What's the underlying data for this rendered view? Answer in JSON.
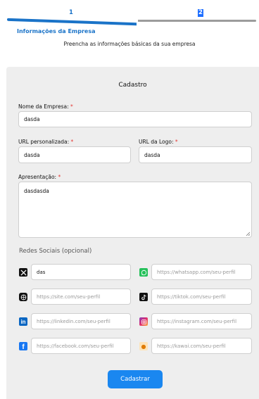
{
  "stepper": {
    "step1": "1",
    "step2": "2",
    "title": "Informações da Empresa",
    "subtitle": "Preencha as informações básicas da sua empresa"
  },
  "form": {
    "title": "Cadastro",
    "company_name": {
      "label": "Nome da Empresa:",
      "required": "*",
      "value": "dasda"
    },
    "custom_url": {
      "label": "URL personalizada:",
      "required": "*",
      "value": "dasda"
    },
    "logo_url": {
      "label": "URL da Logo:",
      "required": "*",
      "value": "dasda"
    },
    "presentation": {
      "label": "Apresentação:",
      "required": "*",
      "value": "dasdasda"
    },
    "social_title": "Redes Sociais (opcional)",
    "social": {
      "x": {
        "icon": "x-icon",
        "value": "das",
        "placeholder": ""
      },
      "whatsapp": {
        "icon": "whatsapp-icon",
        "placeholder": "https://whatsapp.com/seu-perfil"
      },
      "site": {
        "icon": "globe-icon",
        "placeholder": "https://site.com/seu-perfil"
      },
      "tiktok": {
        "icon": "tiktok-icon",
        "placeholder": "https://tiktok.com/seu-perfil"
      },
      "linkedin": {
        "icon": "linkedin-icon",
        "placeholder": "https://linkedin.com/seu-perfil"
      },
      "instagram": {
        "icon": "instagram-icon",
        "placeholder": "https://instagram.com/seu-perfil"
      },
      "facebook": {
        "icon": "facebook-icon",
        "placeholder": "https://facebook.com/seu-perfil"
      },
      "kawai": {
        "icon": "kawai-icon",
        "placeholder": "https://kawai.com/seu-perfil"
      }
    },
    "submit_label": "Cadastrar"
  },
  "colors": {
    "accent": "#1a73c8",
    "button": "#1a87f0",
    "required": "#e53935",
    "card_bg": "#eeeeee"
  }
}
